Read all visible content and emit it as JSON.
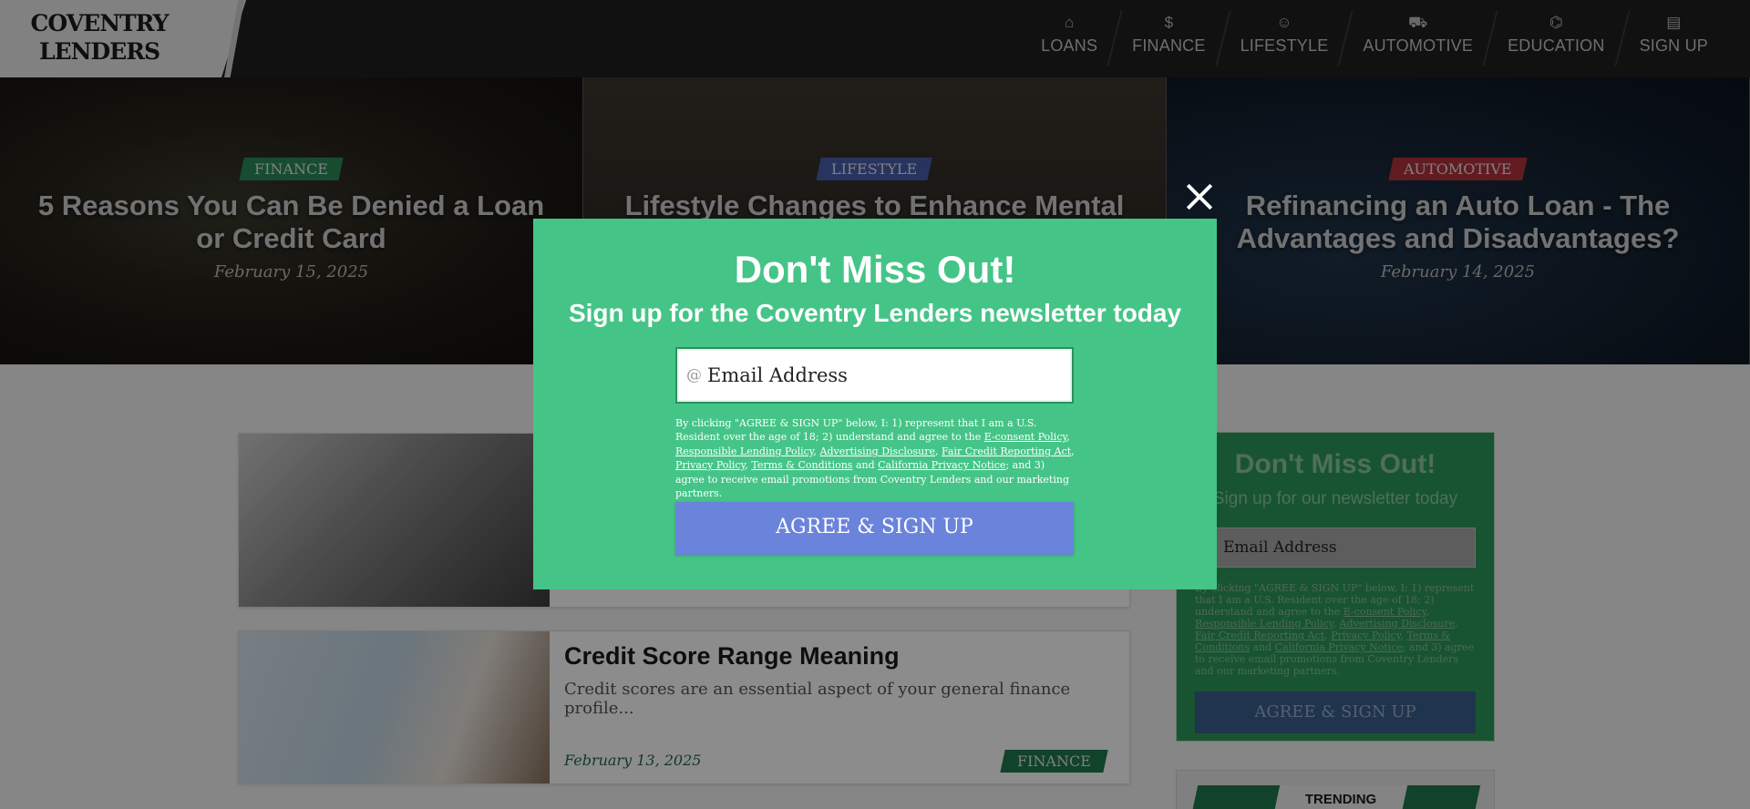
{
  "brand": {
    "logo_line1": "COVENTRY",
    "logo_line2": "LENDERS"
  },
  "nav": [
    {
      "label": "LOANS",
      "icon": "hand-coin-icon",
      "glyph": "⌂"
    },
    {
      "label": "FINANCE",
      "icon": "dollar-icon",
      "glyph": "$"
    },
    {
      "label": "LIFESTYLE",
      "icon": "smiley-icon",
      "glyph": "☺"
    },
    {
      "label": "AUTOMOTIVE",
      "icon": "car-icon",
      "glyph": "⛟"
    },
    {
      "label": "EDUCATION",
      "icon": "graduation-cap-icon",
      "glyph": "⌬"
    },
    {
      "label": "SIGN UP",
      "icon": "clipboard-icon",
      "glyph": "▤"
    }
  ],
  "hero": [
    {
      "category": "FINANCE",
      "title": "5 Reasons You Can Be Denied a Loan or Credit Card",
      "date": "February 15, 2025"
    },
    {
      "category": "LIFESTYLE",
      "title": "Lifestyle Changes to Enhance Mental",
      "date": ""
    },
    {
      "category": "AUTOMOTIVE",
      "title": "Refinancing an Auto Loan - The Advantages and Disadvantages?",
      "date": "February 14, 2025"
    }
  ],
  "articles": [
    {
      "title": "",
      "excerpt": "",
      "date": "",
      "tag": ""
    },
    {
      "title": "Credit Score Range Meaning",
      "excerpt": "Credit scores are an essential aspect of your general finance profile...",
      "date": "February 13, 2025",
      "tag": "FINANCE"
    }
  ],
  "sidebar": {
    "title": "Don't Miss Out!",
    "subtitle": "Sign up for our newsletter today",
    "input_placeholder": "Email Address",
    "terms_start": "By clicking \"AGREE & SIGN UP\" below, I: 1) represent that I am a U.S. Resident over the age of 18; 2) understand and agree to the",
    "button": "AGREE & SIGN UP",
    "trending": "TRENDING"
  },
  "modal": {
    "title": "Don't Miss Out!",
    "subtitle": "Sign up for the Coventry Lenders newsletter today",
    "at_symbol": "@",
    "input_placeholder": "Email Address",
    "terms": {
      "p1": "By clicking \"AGREE & SIGN UP\" below, I: 1) represent that I am a U.S. Resident over the age of 18; 2) understand and agree to the ",
      "links": [
        "E-consent Policy",
        "Responsible Lending Policy",
        "Advertising Disclosure",
        "Fair Credit Reporting Act",
        "Privacy Policy",
        "Terms & Conditions",
        "California Privacy Notice"
      ],
      "and": " and ",
      "p2": "; and 3) agree to receive email promotions from Coventry Lenders and our marketing partners."
    },
    "button": "AGREE & SIGN UP",
    "close_icon": "close-icon"
  },
  "colors": {
    "modal_bg": "#45c487",
    "modal_button": "#6a83db",
    "header_bg": "#1f1f1f",
    "accent_green": "#1e7a4b",
    "badge_finance": "#2a8a5a",
    "badge_lifestyle": "#4a5fb0",
    "badge_automotive": "#b2323d"
  }
}
